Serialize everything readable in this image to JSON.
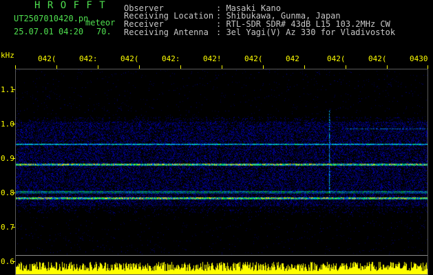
{
  "program_title": "H R O F F T",
  "file_name": "UT2507010420.pn",
  "mode": "meteor",
  "timestamp": "25.07.01 04:20",
  "value": "70.",
  "header_labels": [
    "Observer",
    "Receiving Location",
    "Receiver",
    "Receiving Antenna"
  ],
  "header_values": [
    ": Masaki Kano",
    ": Shibukawa, Gunma, Japan",
    ": RTL-SDR SDR# 43dB L15 103.2MHz CW",
    ": 3el Yagi(V) Az 330 for Vladivostok"
  ],
  "y_unit": "kHz",
  "y_ticks": [
    "1.1",
    "1.0",
    "0.9",
    "0.8",
    "0.7",
    "0.6"
  ],
  "x_ticks": [
    "042(",
    "042:",
    "042(",
    "042:",
    "042!",
    "042(",
    "042",
    "042(",
    "042(",
    "0430"
  ],
  "colors": {
    "background": "#000000",
    "title": "#4fe04f",
    "axis": "#ffff00",
    "header": "#c8c8c8"
  }
}
